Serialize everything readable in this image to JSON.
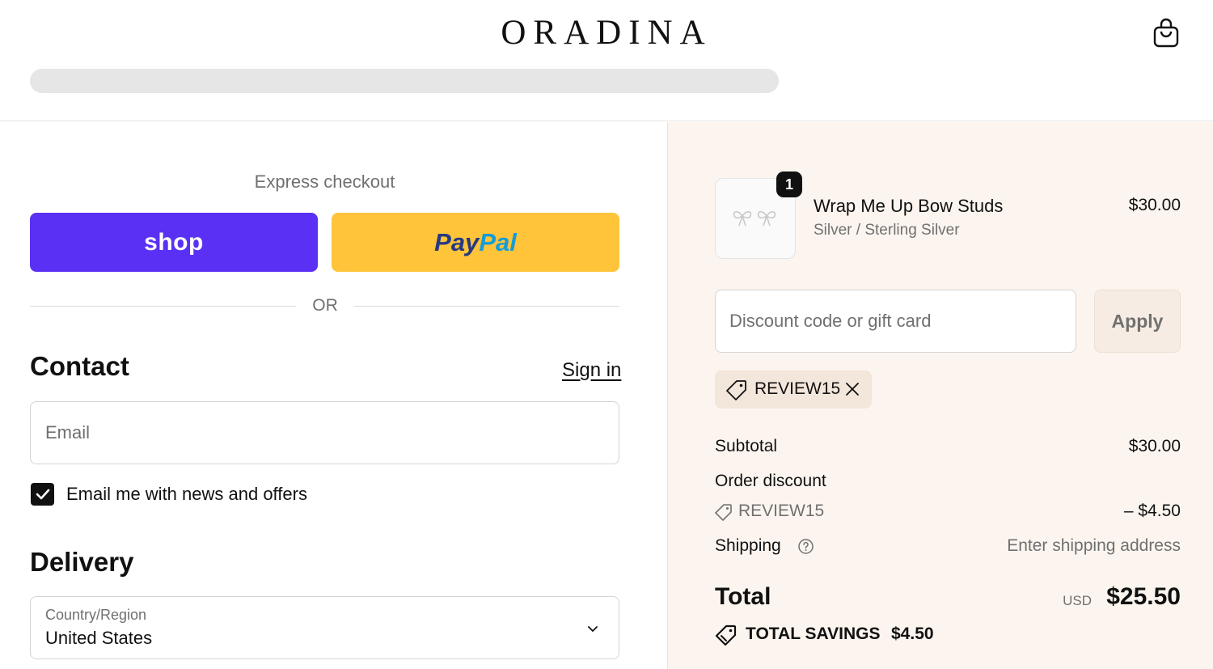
{
  "header": {
    "brand": "ORADINA",
    "cart_icon": "shopping-bag-icon",
    "progress_fraction": 1.0
  },
  "express": {
    "label": "Express checkout",
    "shop_label": "shop",
    "paypal_part1": "Pay",
    "paypal_part2": "Pal",
    "or_label": "OR"
  },
  "contact": {
    "title": "Contact",
    "sign_in": "Sign in",
    "email_placeholder": "Email",
    "newsletter_label": "Email me with news and offers",
    "newsletter_checked": true
  },
  "delivery": {
    "title": "Delivery",
    "country_label": "Country/Region",
    "country_value": "United States"
  },
  "order": {
    "item": {
      "quantity": "1",
      "name": "Wrap Me Up Bow Studs",
      "variant": "Silver / Sterling Silver",
      "price": "$30.00"
    },
    "discount_placeholder": "Discount code or gift card",
    "apply_label": "Apply",
    "applied_code": "REVIEW15",
    "subtotal_label": "Subtotal",
    "subtotal_value": "$30.00",
    "order_discount_label": "Order discount",
    "discount_code": "REVIEW15",
    "discount_value": "– $4.50",
    "shipping_label": "Shipping",
    "shipping_value": "Enter shipping address",
    "total_label": "Total",
    "currency": "USD",
    "total_value": "$25.50",
    "savings_label": "TOTAL SAVINGS",
    "savings_value": "$4.50"
  },
  "colors": {
    "shop_purple": "#5a31f4",
    "paypal_yellow": "#ffc439",
    "summary_bg": "#fcf5ef"
  }
}
